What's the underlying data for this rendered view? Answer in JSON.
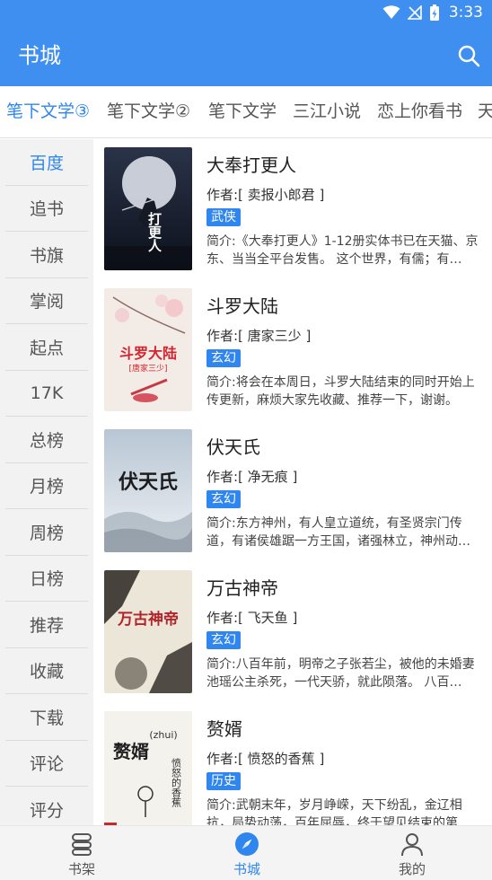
{
  "status_bar": {
    "time": "3:33"
  },
  "app_bar": {
    "title": "书城"
  },
  "tabs": [
    {
      "label": "笔下文学③",
      "active": true
    },
    {
      "label": "笔下文学②"
    },
    {
      "label": "笔下文学"
    },
    {
      "label": "三江小说"
    },
    {
      "label": "恋上你看书"
    },
    {
      "label": "天"
    }
  ],
  "sidebar": {
    "items": [
      {
        "label": "百度",
        "active": true
      },
      {
        "label": "追书"
      },
      {
        "label": "书旗"
      },
      {
        "label": "掌阅"
      },
      {
        "label": "起点"
      },
      {
        "label": "17K"
      },
      {
        "label": "总榜"
      },
      {
        "label": "月榜"
      },
      {
        "label": "周榜"
      },
      {
        "label": "日榜"
      },
      {
        "label": "推荐"
      },
      {
        "label": "收藏"
      },
      {
        "label": "下载"
      },
      {
        "label": "评论"
      },
      {
        "label": "评分"
      }
    ]
  },
  "books": [
    {
      "title": "大奉打更人",
      "author": "作者:[ 卖报小郎君 ]",
      "tag": "武侠",
      "intro": "简介:《大奉打更人》1-12册实体书已在天猫、京东、当当全平台发售。 这个世界，有儒；有…",
      "cover_text": "打更人"
    },
    {
      "title": "斗罗大陆",
      "author": "作者:[ 唐家三少 ]",
      "tag": "玄幻",
      "intro": "简介:将会在本周日，斗罗大陆结束的同时开始上传更新，麻烦大家先收藏、推荐一下，谢谢。",
      "cover_text": "斗罗大陆",
      "cover_subtext": "[唐家三少]"
    },
    {
      "title": "伏天氏",
      "author": "作者:[ 净无痕 ]",
      "tag": "玄幻",
      "intro": "简介:东方神州，有人皇立道统，有圣贤宗门传道，有诸侯雄踞一方王国，诸强林立，神州动…",
      "cover_text": "伏天氏"
    },
    {
      "title": "万古神帝",
      "author": "作者:[ 飞天鱼 ]",
      "tag": "玄幻",
      "intro": "简介:八百年前，明帝之子张若尘，被他的未婚妻池瑶公主杀死，一代天骄，就此陨落。 八百…",
      "cover_text": "万古神帝"
    },
    {
      "title": "赘婿",
      "author": "作者:[ 愤怒的香蕉 ]",
      "tag": "历史",
      "intro": "简介:武朝末年，岁月峥嵘，天下纷乱，金辽相抗，局势动荡，百年屈辱，终于望见结束的第…",
      "cover_text": "赘婿",
      "cover_subtext": "(zhui)",
      "cover_side": "愤怒的香蕉"
    }
  ],
  "bottom_nav": [
    {
      "label": "书架",
      "icon": "bookshelf-icon"
    },
    {
      "label": "书城",
      "icon": "compass-icon",
      "active": true
    },
    {
      "label": "我的",
      "icon": "person-icon"
    }
  ],
  "colors": {
    "primary": "#3f8ff0",
    "accent": "#2f86ee",
    "tag_bg": "#2f86ee",
    "sidebar_bg": "#f2f2f2"
  }
}
